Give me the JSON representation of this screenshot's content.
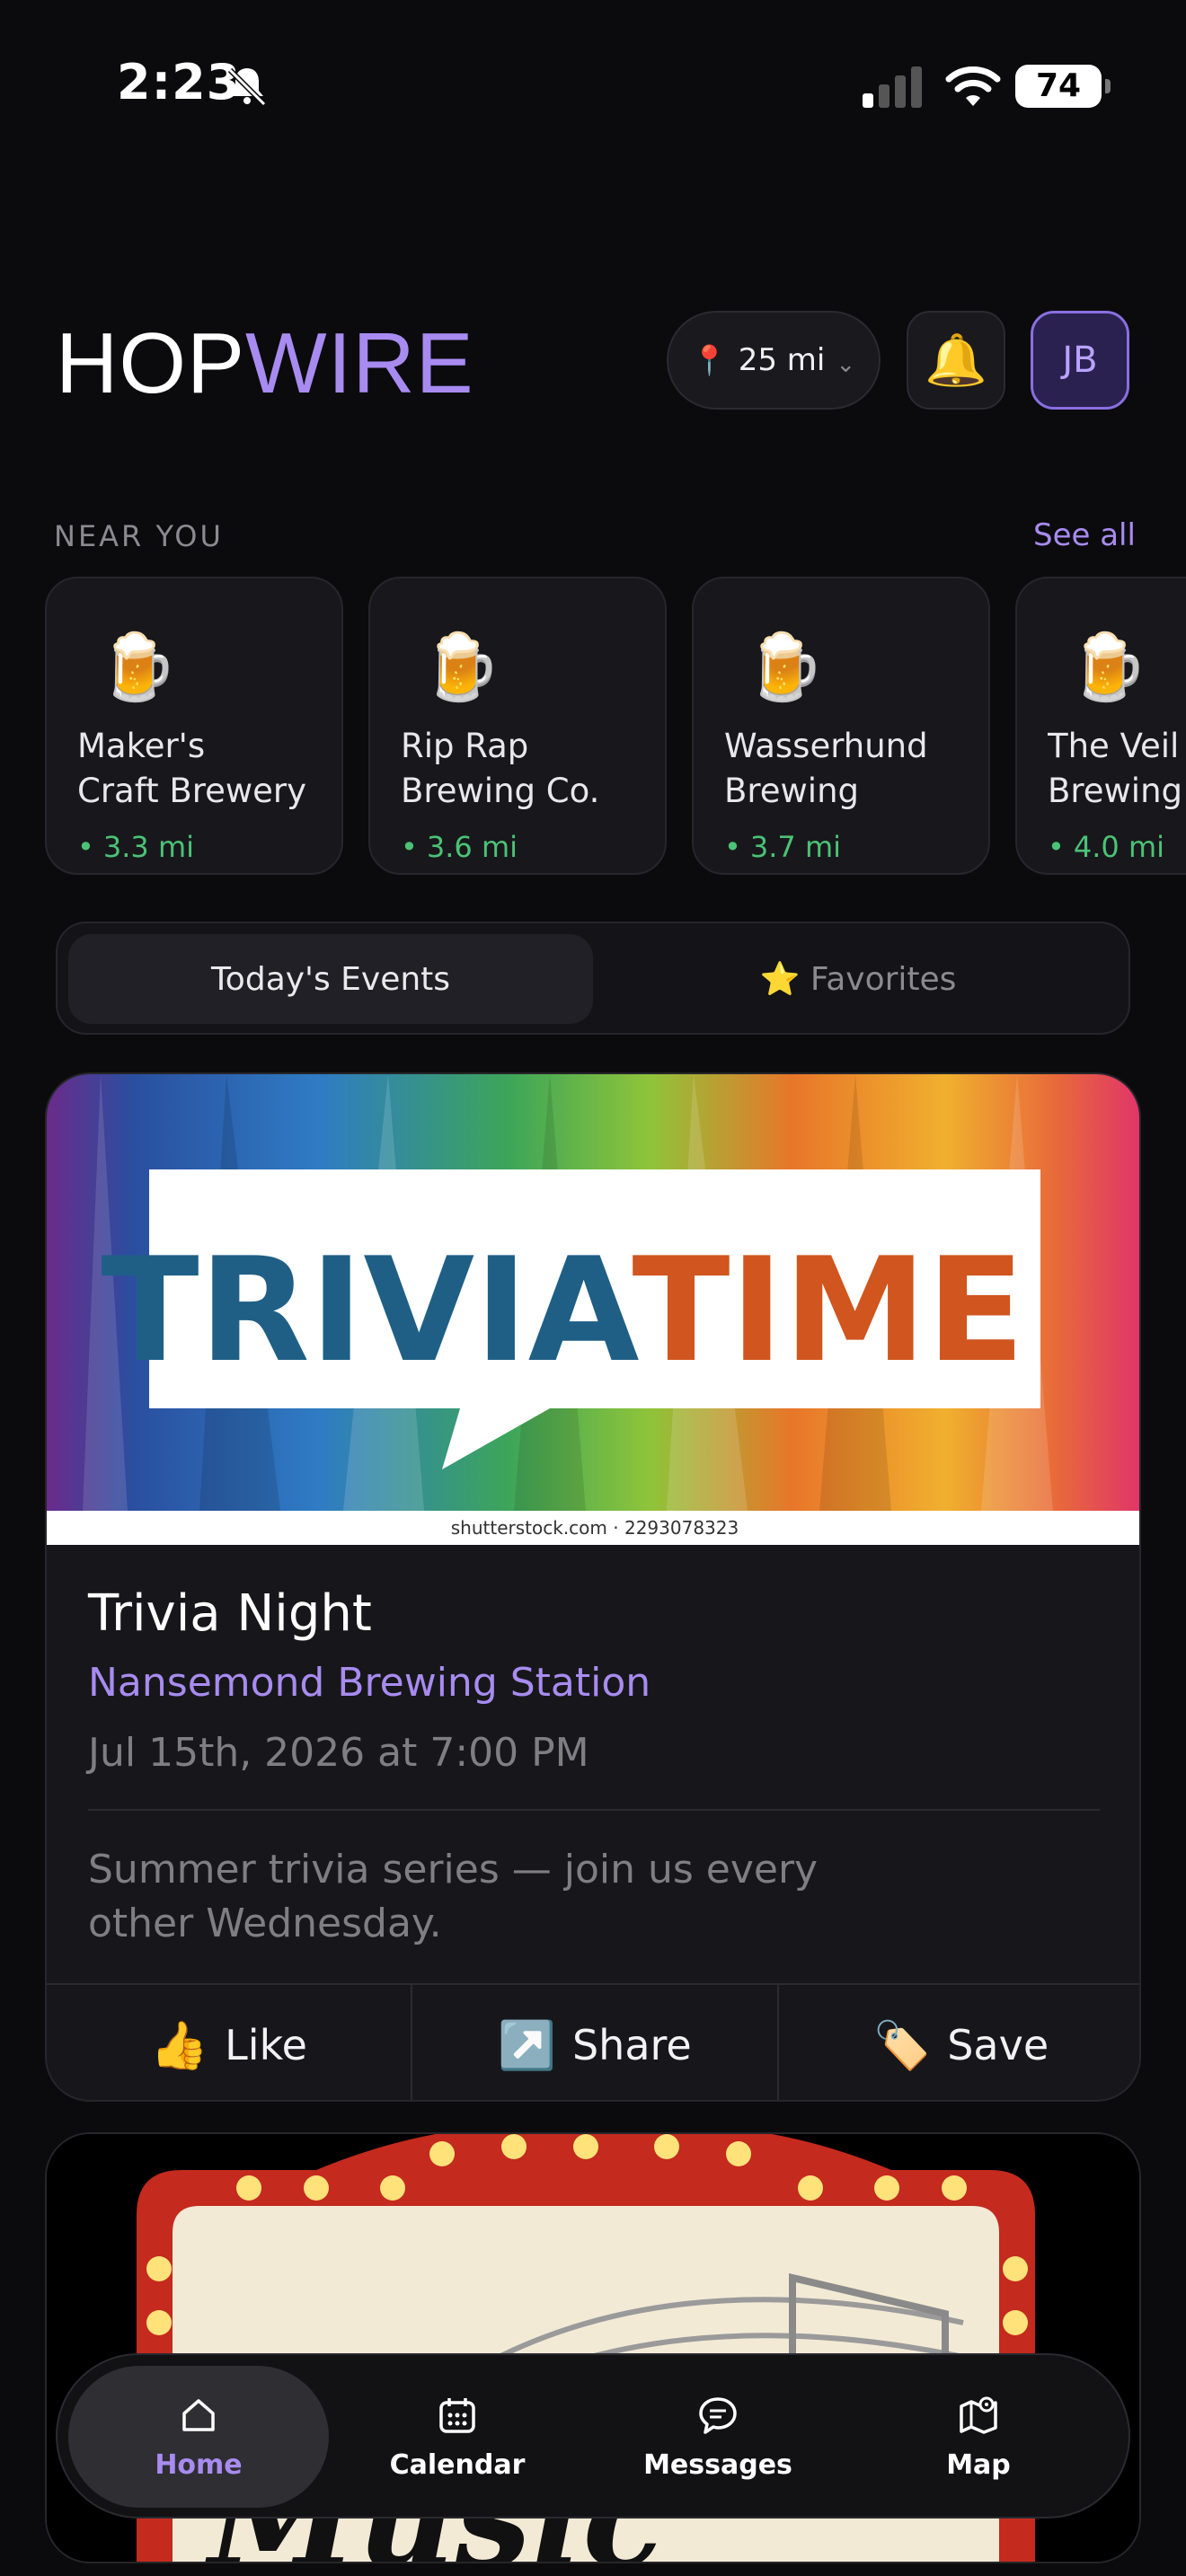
{
  "status_bar": {
    "time": "2:23",
    "battery": "74"
  },
  "header": {
    "logo_part1": "HOP",
    "logo_part2": "WIRE",
    "radius_icon": "📍",
    "radius_label": "25 mi",
    "radius_chevron": "⌄",
    "bell_icon": "🔔",
    "avatar_initials": "JB"
  },
  "near_you": {
    "label": "NEAR YOU",
    "see_all": "See all",
    "breweries": [
      {
        "icon": "🍺",
        "name": "Maker's\nCraft Brewery",
        "distance": "3.3 mi"
      },
      {
        "icon": "🍺",
        "name": "Rip Rap\nBrewing Co.",
        "distance": "3.6 mi"
      },
      {
        "icon": "🍺",
        "name": "Wasserhund\nBrewing",
        "distance": "3.7 mi"
      },
      {
        "icon": "🍺",
        "name": "The Veil\nBrewing Co.",
        "distance": "4.0 mi"
      }
    ]
  },
  "tabs": {
    "events": "Today's Events",
    "favorites": "⭐ Favorites"
  },
  "event": {
    "banner_text_1": "TRIVIA",
    "banner_text_2": "TIME",
    "watermark": "shutterstock.com · 2293078323",
    "title": "Trivia Night",
    "venue": "Nansemond Brewing Station",
    "date": "Jul 15th, 2026 at 7:00 PM",
    "description": "Summer trivia series — join us every other Wednesday.",
    "like_icon": "👍",
    "like_label": "Like",
    "share_icon": "↗️",
    "share_label": "Share",
    "save_icon": "🏷️",
    "save_label": "Save"
  },
  "next_event": {
    "banner_text": "Music"
  },
  "nav": {
    "home": "Home",
    "calendar": "Calendar",
    "messages": "Messages",
    "map": "Map"
  },
  "colors": {
    "accent": "#a88bf0",
    "distance_green": "#4cc276",
    "background": "#0b0b0d"
  }
}
